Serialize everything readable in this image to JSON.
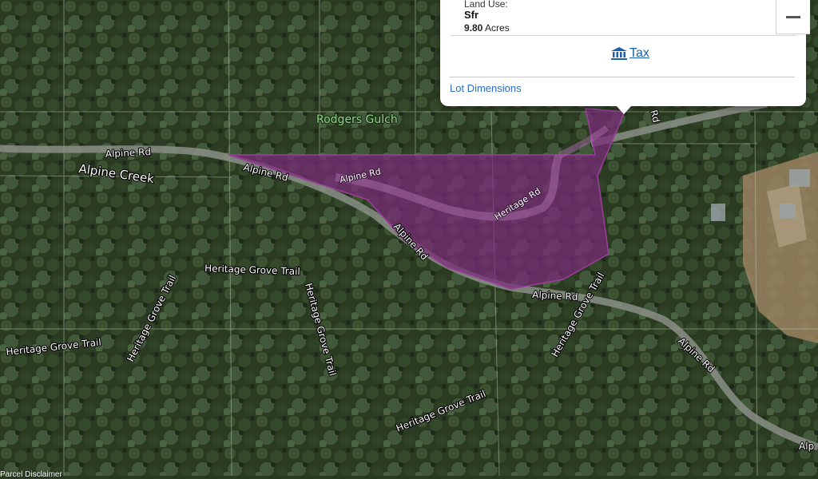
{
  "map": {
    "place_labels": {
      "rodgers_gulch": "Rodgers Gulch",
      "alpine_creek": "Alpine Creek"
    },
    "road_labels": {
      "alpine_rd": "Alpine Rd",
      "heritage_rd": "Heritage Rd",
      "heritage_grove_trail": "Heritage Grove Trail",
      "alpine_rd_partial": "Alp",
      "rd_partial": "Rd"
    },
    "parcel_color": "#7a2a7a"
  },
  "popup": {
    "land_use_label": "Land Use:",
    "land_use_value": "Sfr",
    "acres_value": "9.80",
    "acres_unit": "Acres",
    "tax_link": "Tax",
    "lot_dimensions_link": "Lot Dimensions"
  },
  "footer": {
    "disclaimer": "Parcel Disclaimer"
  }
}
